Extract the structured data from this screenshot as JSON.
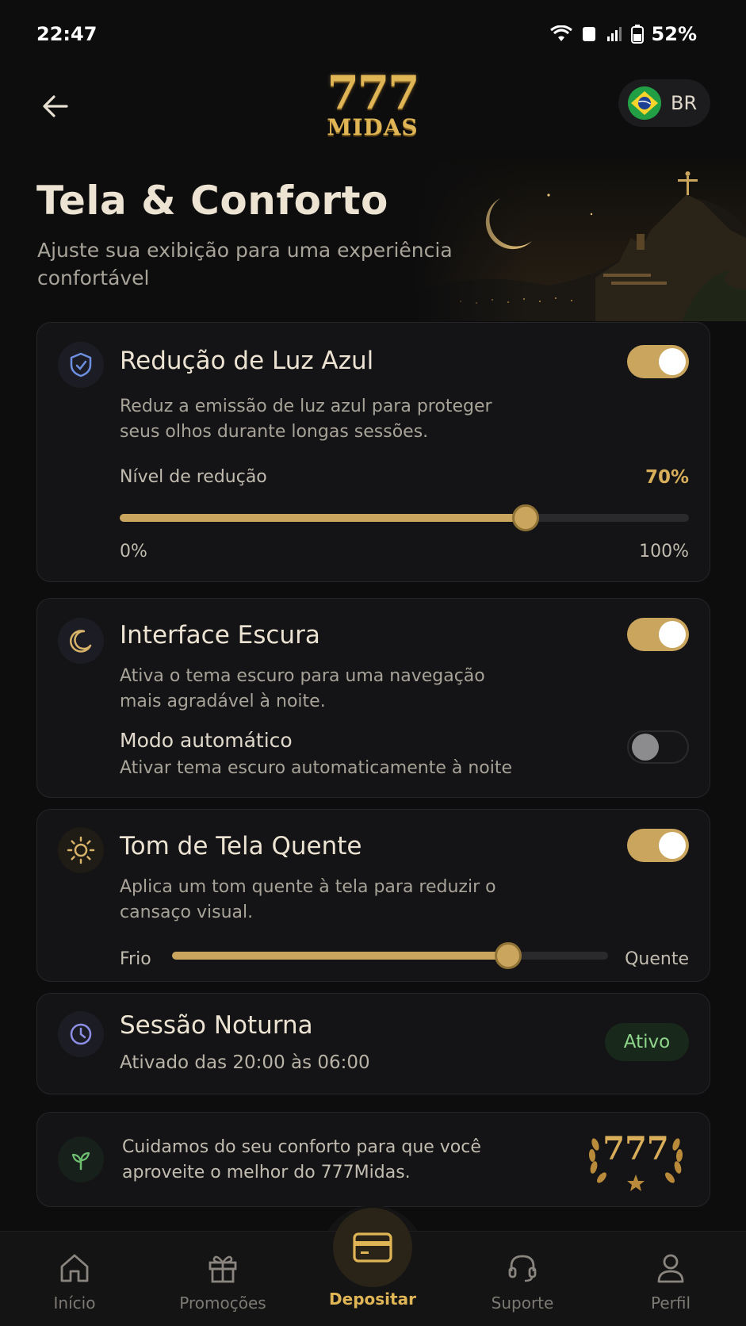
{
  "status_bar": {
    "time": "22:47",
    "battery": "52%"
  },
  "header": {
    "logo_number": "777",
    "logo_word": "MIDAS",
    "region_code": "BR"
  },
  "hero": {
    "title": "Tela & Conforto",
    "subtitle": "Ajuste sua exibição para uma experiência confortável"
  },
  "blue_light": {
    "title": "Redução de Luz Azul",
    "description": "Reduz a emissão de luz azul para proteger seus olhos durante longas sessões.",
    "enabled": true,
    "level_label": "Nível de redução",
    "level_value": "70%",
    "level_fraction": 0.713,
    "min_label": "0%",
    "max_label": "100%"
  },
  "dark_mode": {
    "title": "Interface Escura",
    "description": "Ativa o tema escuro para uma navegação mais agradável à noite.",
    "enabled": true,
    "auto_title": "Modo automático",
    "auto_description": "Ativar tema escuro automaticamente à noite",
    "auto_enabled": false
  },
  "warm_tone": {
    "title": "Tom de Tela Quente",
    "description": "Aplica um tom quente à tela para reduzir o cansaço visual.",
    "enabled": true,
    "min_label": "Frio",
    "max_label": "Quente",
    "level_fraction": 0.77
  },
  "night_session": {
    "title": "Sessão Noturna",
    "schedule": "Ativado das 20:00 às 06:00",
    "status": "Ativo"
  },
  "comfort_note": {
    "text": "Cuidamos do seu conforto para que você aproveite o melhor do 777Midas.",
    "emblem": "777"
  },
  "bottom_nav": {
    "home": "Início",
    "promotions": "Promoções",
    "deposit": "Depositar",
    "support": "Suporte",
    "profile": "Perfil"
  },
  "colors": {
    "accent_gold": "#c9a55e",
    "active_green": "#8fd68c",
    "background": "#0d0d0e"
  }
}
